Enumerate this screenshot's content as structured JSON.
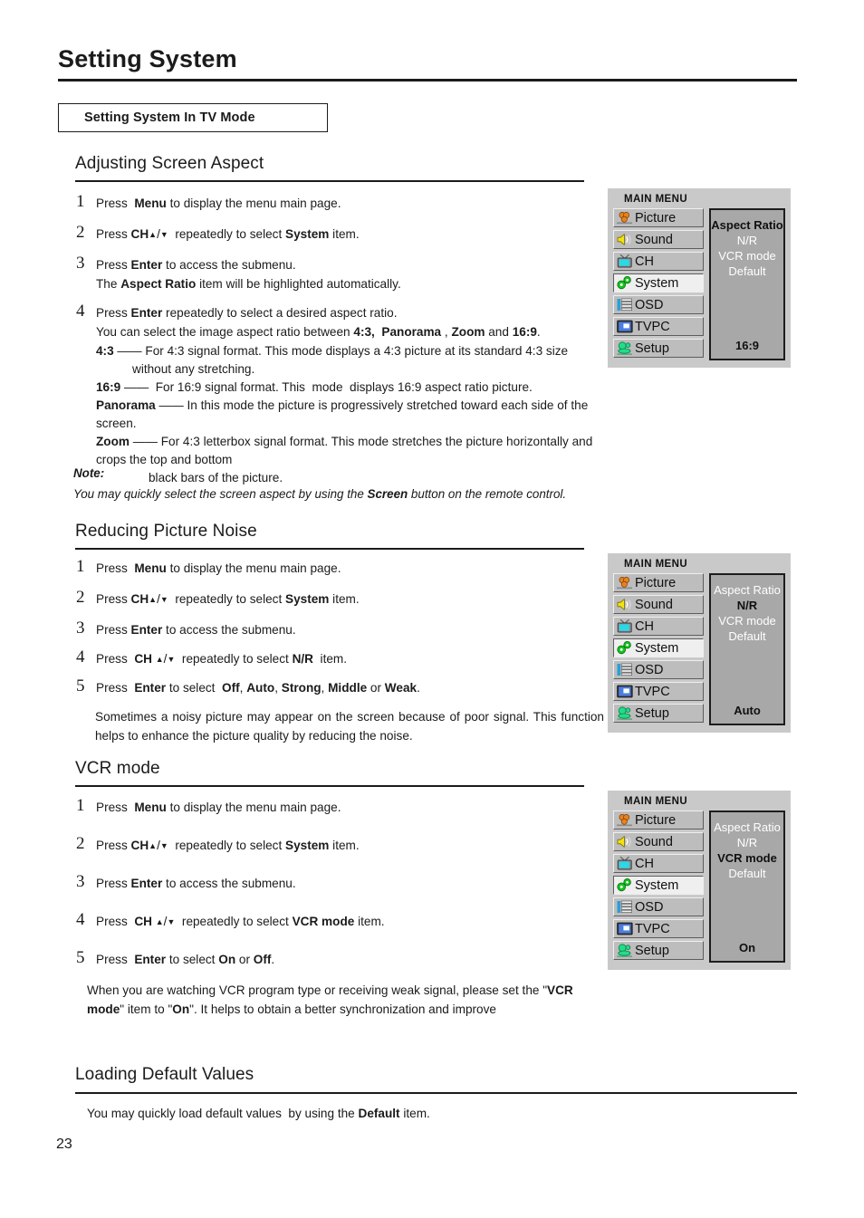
{
  "header": {
    "title": "Setting System",
    "mode_box": "Setting System In TV Mode"
  },
  "sections": {
    "aspect": {
      "heading": "Adjusting Screen Aspect",
      "steps": [
        {
          "num": "1",
          "html": "Press&nbsp; <b>Menu</b> to display the menu main page."
        },
        {
          "num": "2",
          "html": "Press <b>CH</b><span class=\"ar\">&#9650;</span>/<span class=\"ar\">&#9660;</span>&nbsp; repeatedly to select <b>System</b> item."
        },
        {
          "num": "3",
          "html": "Press <b>Enter</b> to access the submenu."
        },
        {
          "num": "4",
          "html": "Press <b>Enter</b> repeatedly to select a desired aspect ratio."
        }
      ],
      "sub_after_3": "The <b>Aspect Ratio</b> item will be highlighted automatically.",
      "sub_after_4": "You can select the image aspect ratio between <b>4:3,&nbsp; Panorama</b> , <b>Zoom</b> and <b>16:9</b>.",
      "definitions": [
        "<b>4:3</b> &#8212;&#8212; For 4:3 signal format. This mode displays a 4:3 picture at its standard 4:3 size",
        "without any stretching.",
        "<b>16:9</b> &#8212;&#8212;&nbsp; For 16:9 signal format. This&nbsp; mode&nbsp; displays 16:9 aspect ratio picture.",
        "<b>Panorama</b> &#8212;&#8212; In this mode the picture is progressively stretched toward each side of the screen.",
        "<b>Zoom</b> &#8212;&#8212; For 4:3 letterbox signal format. This mode stretches the picture horizontally and crops the top and bottom",
        "black bars of the picture."
      ],
      "note_title": "Note:",
      "note_text": "You may quickly select the screen aspect by using the <b>Screen</b> button on the remote control."
    },
    "noise": {
      "heading": "Reducing Picture Noise",
      "steps": [
        {
          "num": "1",
          "html": "Press&nbsp; <b>Menu</b> to display the menu main page."
        },
        {
          "num": "2",
          "html": "Press <b>CH</b><span class=\"ar\">&#9650;</span>/<span class=\"ar\">&#9660;</span>&nbsp; repeatedly to select <b>System</b> item."
        },
        {
          "num": "3",
          "html": "Press <b>Enter</b> to access the submenu."
        },
        {
          "num": "4",
          "html": "Press&nbsp; <b>CH</b> <span class=\"ar\">&#9650;</span>/<span class=\"ar\">&#9660;</span>&nbsp; repeatedly to select <b>N/R</b>&nbsp; item."
        },
        {
          "num": "5",
          "html": "Press&nbsp; <b>Enter</b> to select&nbsp; <b>Off</b>, <b>Auto</b>, <b>Strong</b>, <b>Middle</b> or <b>Weak</b>."
        }
      ],
      "paragraph": "Sometimes a noisy picture may appear on the screen because of poor signal. This function helps to enhance the picture quality by reducing the noise."
    },
    "vcr": {
      "heading": "VCR mode",
      "steps": [
        {
          "num": "1",
          "html": "Press&nbsp; <b>Menu</b> to display the menu main page."
        },
        {
          "num": "2",
          "html": "Press <b>CH</b><span class=\"ar\">&#9650;</span>/<span class=\"ar\">&#9660;</span>&nbsp; repeatedly to select <b>System</b> item."
        },
        {
          "num": "3",
          "html": "Press <b>Enter</b> to access the submenu."
        },
        {
          "num": "4",
          "html": "Press&nbsp; <b>CH</b> <span class=\"ar\">&#9650;</span>/<span class=\"ar\">&#9660;</span>&nbsp; repeatedly to select <b>VCR mode</b> item."
        },
        {
          "num": "5",
          "html": "Press&nbsp; <b>Enter</b> to select <b>On</b> or <b>Off</b>."
        }
      ],
      "paragraph": "When you are watching VCR program type or receiving weak signal, please set the \"<b>VCR mode</b>\" item to \"<b>On</b>\". It helps to obtain a better synchronization and improve"
    },
    "defaults": {
      "heading": "Loading Default Values",
      "paragraph": "You may quickly load default values&nbsp; by using the <b>Default</b> item."
    }
  },
  "osd_menus": [
    {
      "title": "MAIN MENU",
      "items": [
        {
          "label": "Picture",
          "icon": "picture-icon",
          "selected": false
        },
        {
          "label": "Sound",
          "icon": "sound-icon",
          "selected": false
        },
        {
          "label": "CH",
          "icon": "channel-icon",
          "selected": false
        },
        {
          "label": "System",
          "icon": "system-icon",
          "selected": true
        },
        {
          "label": "OSD",
          "icon": "osd-icon",
          "selected": false
        },
        {
          "label": "TVPC",
          "icon": "tvpc-icon",
          "selected": false
        },
        {
          "label": "Setup",
          "icon": "setup-icon",
          "selected": false
        }
      ],
      "options": [
        {
          "label": "Aspect Ratio",
          "highlighted": true
        },
        {
          "label": "N/R",
          "highlighted": false
        },
        {
          "label": "VCR mode",
          "highlighted": false
        },
        {
          "label": "Default",
          "highlighted": false
        }
      ],
      "value": "16:9"
    },
    {
      "title": "MAIN MENU",
      "items": [
        {
          "label": "Picture",
          "icon": "picture-icon",
          "selected": false
        },
        {
          "label": "Sound",
          "icon": "sound-icon",
          "selected": false
        },
        {
          "label": "CH",
          "icon": "channel-icon",
          "selected": false
        },
        {
          "label": "System",
          "icon": "system-icon",
          "selected": true
        },
        {
          "label": "OSD",
          "icon": "osd-icon",
          "selected": false
        },
        {
          "label": "TVPC",
          "icon": "tvpc-icon",
          "selected": false
        },
        {
          "label": "Setup",
          "icon": "setup-icon",
          "selected": false
        }
      ],
      "options": [
        {
          "label": "Aspect Ratio",
          "highlighted": false
        },
        {
          "label": "N/R",
          "highlighted": true
        },
        {
          "label": "VCR mode",
          "highlighted": false
        },
        {
          "label": "Default",
          "highlighted": false
        }
      ],
      "value": "Auto"
    },
    {
      "title": "MAIN MENU",
      "items": [
        {
          "label": "Picture",
          "icon": "picture-icon",
          "selected": false
        },
        {
          "label": "Sound",
          "icon": "sound-icon",
          "selected": false
        },
        {
          "label": "CH",
          "icon": "channel-icon",
          "selected": false
        },
        {
          "label": "System",
          "icon": "system-icon",
          "selected": true
        },
        {
          "label": "OSD",
          "icon": "osd-icon",
          "selected": false
        },
        {
          "label": "TVPC",
          "icon": "tvpc-icon",
          "selected": false
        },
        {
          "label": "Setup",
          "icon": "setup-icon",
          "selected": false
        }
      ],
      "options": [
        {
          "label": "Aspect Ratio",
          "highlighted": false
        },
        {
          "label": "N/R",
          "highlighted": false
        },
        {
          "label": "VCR mode",
          "highlighted": true
        },
        {
          "label": "Default",
          "highlighted": false
        }
      ],
      "value": "On"
    }
  ],
  "page_number": "23",
  "colors": {
    "osd_background": "#c9c9c9",
    "osd_panel": "#a8a8a8",
    "icon_picture": "#e8821e",
    "icon_sound": "#f2e312",
    "icon_channel": "#2ad8e8",
    "icon_system": "#15c21e",
    "icon_osd": "#2c9fd6",
    "icon_tvpc": "#4b7ee0",
    "icon_setup": "#22dd88"
  }
}
